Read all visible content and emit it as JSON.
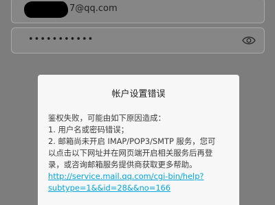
{
  "login_form": {
    "email_value": "7@qq.com",
    "password_mask": "•••••••••••",
    "password_toggle_icon": "eye-icon"
  },
  "dialog": {
    "title": "帐户设置错误",
    "lines": [
      "鉴权失败，可能由如下原因造成：",
      "1. 用户名或密码错误；",
      "2. 邮箱尚未开启 IMAP/POP3/SMTP 服务，您可",
      "以点击以下网址并在网页端开启相关服务后再登",
      "录，或咨询邮箱服务提供商获取更多帮助。"
    ],
    "help_link_line1": "http://service.mail.qq.com/cgi-bin/help?",
    "help_link_line2": "subtype=1&&id=28&&no=166"
  }
}
